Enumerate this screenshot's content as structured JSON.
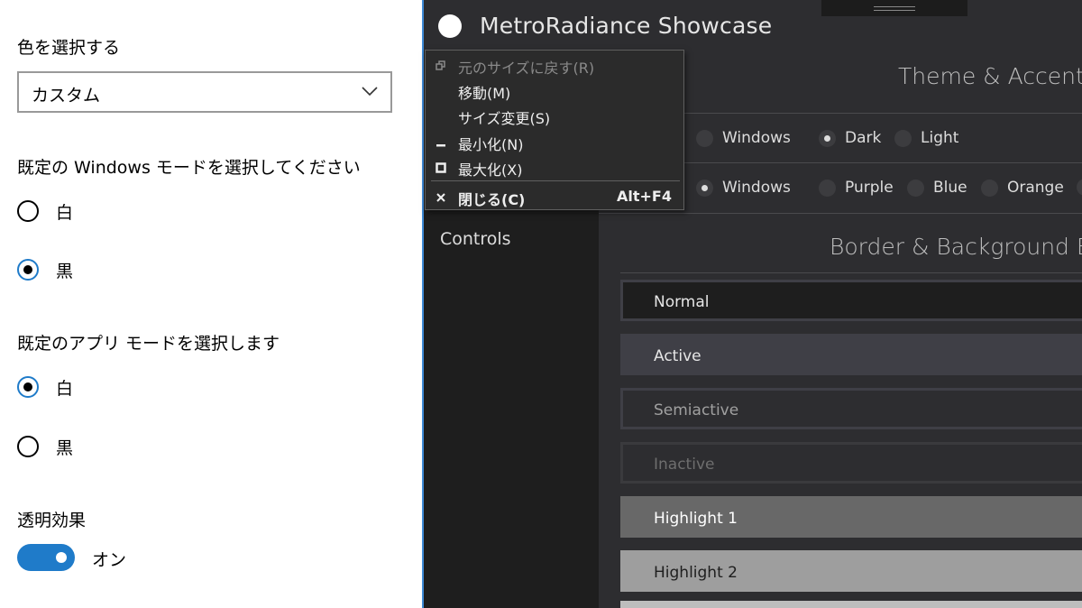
{
  "settings": {
    "color_label": "色を選択する",
    "color_value": "カスタム",
    "windows_mode_label": "既定の Windows モードを選択してください",
    "windows_mode_options": [
      "白",
      "黒"
    ],
    "windows_mode_selected": "黒",
    "app_mode_label": "既定のアプリ モードを選択します",
    "app_mode_options": [
      "白",
      "黒"
    ],
    "app_mode_selected": "白",
    "transparency_label": "透明効果",
    "transparency_value": "オン",
    "accent_color": "#1f7bc9"
  },
  "app": {
    "title": "MetroRadiance Showcase",
    "sidebar": {
      "items": [
        "Controls"
      ]
    },
    "theme_section": {
      "title": "Theme & Accent",
      "theme_options": [
        "Windows",
        "Dark",
        "Light"
      ],
      "theme_selected": "Dark",
      "accent_options": [
        "Windows",
        "Purple",
        "Blue",
        "Orange"
      ],
      "accent_selected": "Windows"
    },
    "brush_section": {
      "title": "Border & Background Brushes",
      "rows": [
        {
          "label": "Normal",
          "bg": "#1e1e1e",
          "border": "#3f3f46",
          "fg": "#e6e6e6"
        },
        {
          "label": "Active",
          "bg": "#3f3f46",
          "border": "#3f3f46",
          "fg": "#e6e6e6"
        },
        {
          "label": "Semiactive",
          "bg": "#2d2d30",
          "border": "#3f3f46",
          "fg": "#a0a0a0"
        },
        {
          "label": "Inactive",
          "bg": "#2d2d30",
          "border": "#3a3a3d",
          "fg": "#6e6e6e"
        },
        {
          "label": "Highlight 1",
          "bg": "#686868",
          "border": "#686868",
          "fg": "#ffffff"
        },
        {
          "label": "Highlight 2",
          "bg": "#9e9e9e",
          "border": "#9e9e9e",
          "fg": "#1e1e1e"
        }
      ]
    }
  },
  "system_menu": {
    "items": [
      {
        "label": "元のサイズに戻す(R)",
        "icon": "restore-icon",
        "enabled": false
      },
      {
        "label": "移動(M)",
        "icon": "",
        "enabled": true
      },
      {
        "label": "サイズ変更(S)",
        "icon": "",
        "enabled": true
      },
      {
        "label": "最小化(N)",
        "icon": "minimize-icon",
        "enabled": true
      },
      {
        "label": "最大化(X)",
        "icon": "maximize-icon",
        "enabled": true
      }
    ],
    "close": {
      "label": "閉じる(C)",
      "shortcut": "Alt+F4",
      "icon": "close-icon"
    }
  }
}
